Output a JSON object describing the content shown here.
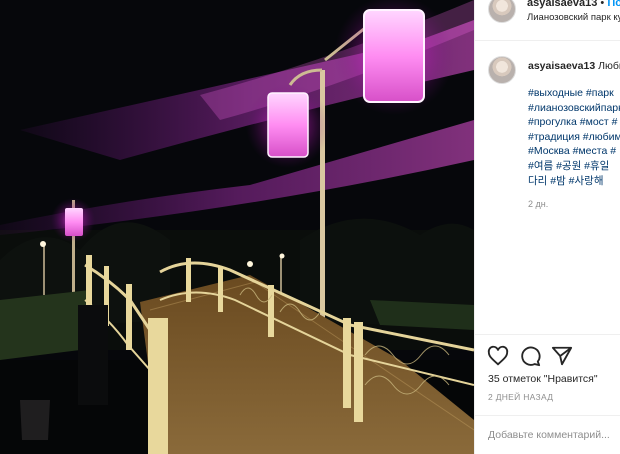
{
  "header": {
    "username": "asyaisaeva13",
    "separator": "•",
    "follow_label": "Подписаться",
    "location": "Лианозовский парк культуры и отдыха"
  },
  "caption": {
    "username": "asyaisaeva13",
    "text_start": "Любимый парк",
    "hashtag_lines": [
      "#выходные #парк",
      "#лианозовскийпарк",
      "#прогулка #мост #",
      "#традиция #любимое",
      "#Москва #места #",
      "#여름 #공원 #휴일",
      "다리 #밤 #사랑해"
    ],
    "time_ago": "2 дн."
  },
  "actions": {
    "like_icon": "heart-icon",
    "comment_icon": "comment-icon",
    "share_icon": "share-icon",
    "likes_text": "35 отметок \"Нравится\"",
    "date_text": "2 ДНЕЙ НАЗАД"
  },
  "comment_box": {
    "placeholder": "Добавьте комментарий..."
  },
  "colors": {
    "link": "#00376b",
    "accent": "#0095f6",
    "muted": "#8e8e8e",
    "lantern_glow": "#ff4fe0"
  }
}
